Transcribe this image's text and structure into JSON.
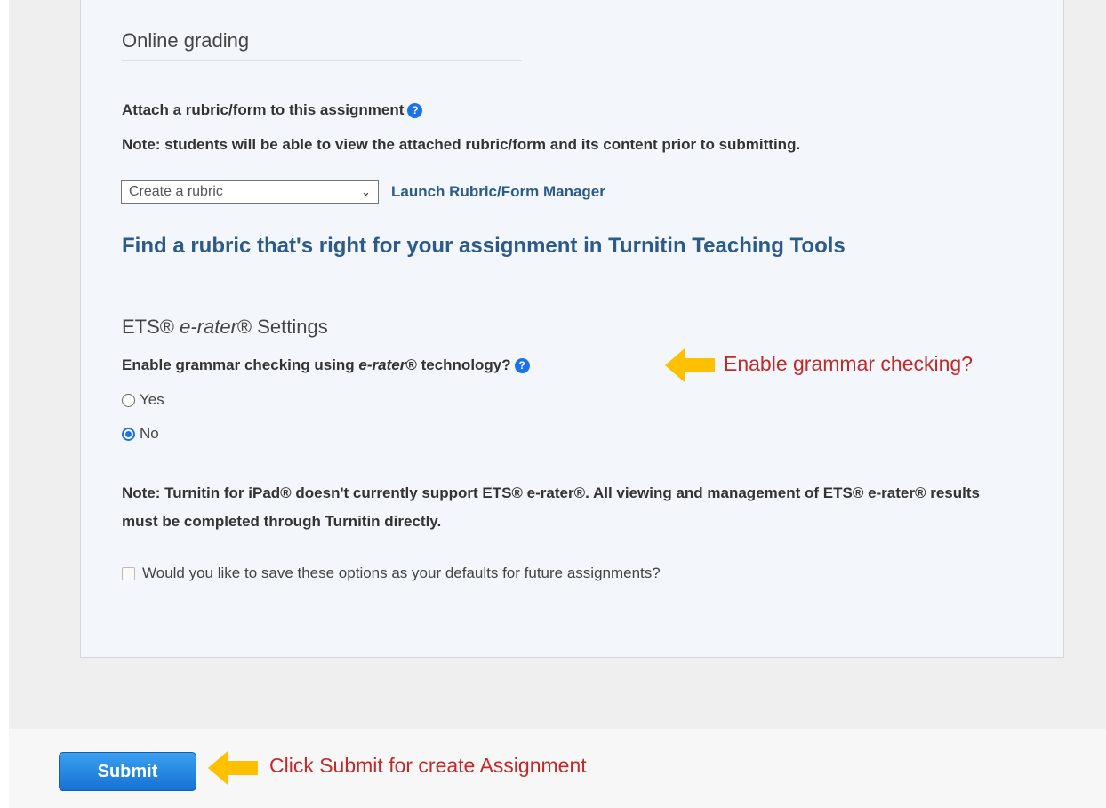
{
  "online_grading": {
    "title": "Online grading",
    "attach_label": "Attach a rubric/form to this assignment",
    "note": "Note: students will be able to view the attached rubric/form and its content prior to submitting.",
    "rubric_select_value": "Create a rubric",
    "launch_link": "Launch Rubric/Form Manager",
    "find_rubric_link": "Find a rubric that's right for your assignment in Turnitin Teaching Tools"
  },
  "ets": {
    "title_prefix": "ETS® ",
    "title_italic": "e-rater",
    "title_suffix": "® Settings",
    "question_prefix": "Enable grammar checking using ",
    "question_italic": "e-rater",
    "question_suffix": "® technology?",
    "options": [
      {
        "label": "Yes",
        "selected": false
      },
      {
        "label": "No",
        "selected": true
      }
    ],
    "note": "Note: Turnitin for iPad® doesn't currently support ETS® e-rater®. All viewing and management of ETS® e-rater® results must be completed through Turnitin directly."
  },
  "defaults_checkbox": {
    "label": "Would you like to save these options as your defaults for future assignments?",
    "checked": false
  },
  "submit_label": "Submit",
  "annotations": {
    "grammar": "Enable grammar checking?",
    "submit": "Click Submit for create Assignment"
  },
  "colors": {
    "accent_blue": "#1a73e8",
    "link_blue": "#2c5b8a",
    "annotation_red": "#c22a2a",
    "arrow_yellow": "#ffc000"
  },
  "icons": {
    "help": "help-circle-icon",
    "arrow": "arrow-left-icon",
    "dropdown": "chevron-down-icon"
  }
}
